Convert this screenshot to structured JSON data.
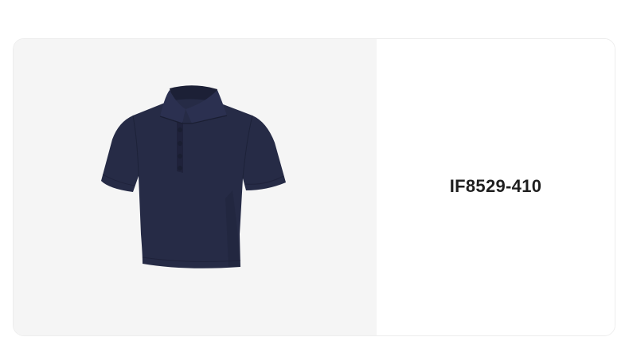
{
  "product": {
    "code": "IF8529-410",
    "image_icon": "navy-cropped-polo-shirt",
    "shirt_color": "#262b46",
    "shirt_shadow": "#1c2036",
    "shirt_highlight": "#30365a",
    "text_color": "#1f1f1f",
    "image_bg": "#f5f5f5"
  }
}
